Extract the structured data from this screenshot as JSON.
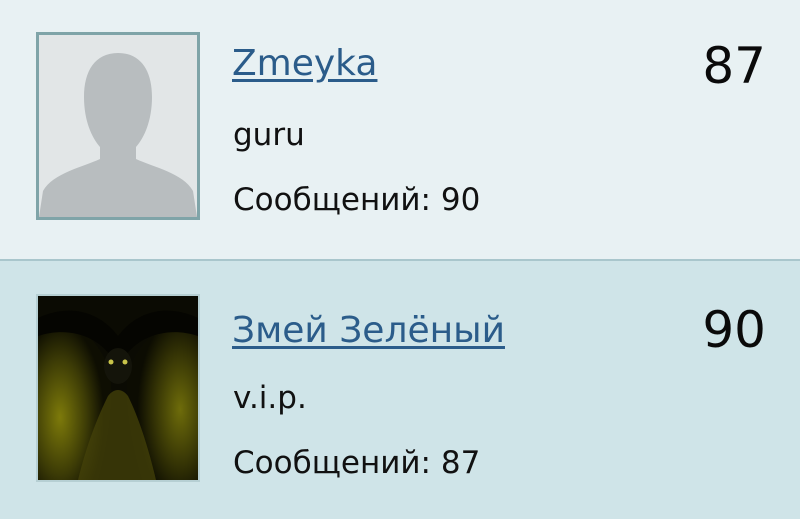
{
  "users": [
    {
      "name": "Zmeyka",
      "rank": "guru",
      "posts_label": "Сообщений:",
      "posts_count": "90",
      "score": "87"
    },
    {
      "name": "Змей Зелёный",
      "rank": "v.i.p.",
      "posts_label": "Сообщений:",
      "posts_count": "87",
      "score": "90"
    }
  ],
  "colors": {
    "row_1_bg": "#e8f1f3",
    "row_2_bg": "#cfe4e8",
    "link": "#2b5c8a"
  }
}
